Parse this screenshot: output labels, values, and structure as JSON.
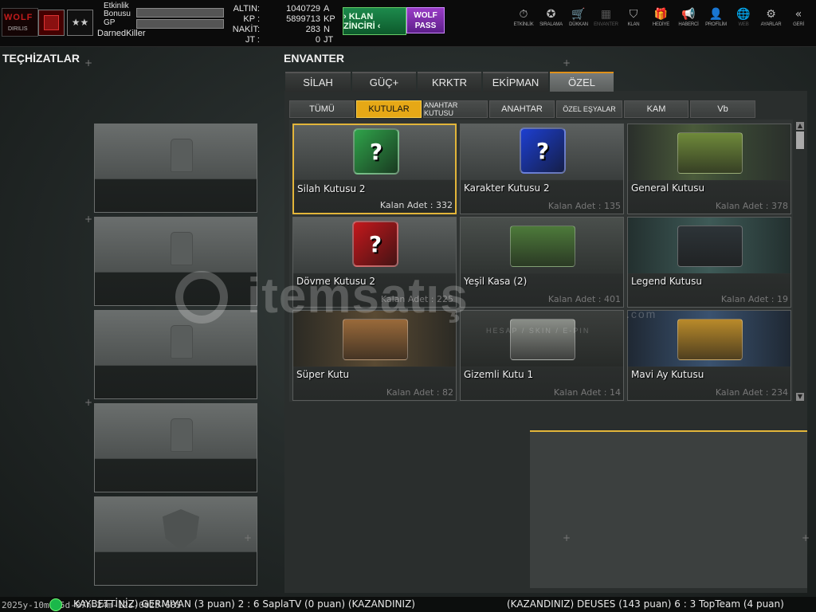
{
  "player": {
    "logo_text": "WOLF",
    "logo_sub": "DIRILIS",
    "rank_stars": "★★",
    "event_bonus_label": "Etkinlik Bonusu",
    "gp_label": "GP",
    "name": "DarnedKiller"
  },
  "currency": {
    "labels": "ALTIN:\nKP :\nNAKİT:\nJT :",
    "values": "1040729\n5899713\n283\n0",
    "units": "A\nKP\nN\nJT"
  },
  "buttons": {
    "klan": "› KLAN ZİNCİRİ ‹",
    "wolf_pass": "WOLF\nPASS"
  },
  "nav": [
    {
      "icon": "stopwatch-icon",
      "glyph": "⏱",
      "label": "ETKİNLİK"
    },
    {
      "icon": "medal-icon",
      "glyph": "✪",
      "label": "SIRALAMA"
    },
    {
      "icon": "cart-icon",
      "glyph": "🛒",
      "label": "DÜKKAN"
    },
    {
      "icon": "inventory-icon",
      "glyph": "▦",
      "label": "ENVANTER"
    },
    {
      "icon": "clan-shield-icon",
      "glyph": "⛉",
      "label": "KLAN"
    },
    {
      "icon": "gift-icon",
      "glyph": "🎁",
      "label": "HEDİYE"
    },
    {
      "icon": "megaphone-icon",
      "glyph": "📢",
      "label": "HABERCİ"
    },
    {
      "icon": "profile-icon",
      "glyph": "👤",
      "label": "PROFİLİM"
    },
    {
      "icon": "globe-icon",
      "glyph": "🌐",
      "label": "WEB"
    },
    {
      "icon": "gear-icon",
      "glyph": "⚙",
      "label": "AYARLAR"
    },
    {
      "icon": "back-arrows-icon",
      "glyph": "«",
      "label": "GERİ"
    }
  ],
  "equipment": {
    "title": "TEÇHİZATLAR"
  },
  "inventory": {
    "title": "ENVANTER",
    "main_tabs": [
      "SİLAH",
      "GÜÇ+",
      "KRKTR",
      "EKİPMAN",
      "ÖZEL"
    ],
    "active_main_tab": "ÖZEL",
    "sub_tabs": [
      "TÜMÜ",
      "KUTULAR",
      "ANAHTAR KUTUSU",
      "ANAHTAR",
      "ÖZEL EŞYALAR",
      "KAM",
      "Vb"
    ],
    "active_sub_tab": "KUTULAR",
    "items": [
      {
        "name": "Silah Kutusu 2",
        "qty": "Kalan Adet : 332",
        "icon": "green-mystery-box-icon"
      },
      {
        "name": "Karakter Kutusu 2",
        "qty": "Kalan Adet : 135",
        "icon": "blue-mystery-box-icon"
      },
      {
        "name": "General Kutusu",
        "qty": "Kalan Adet : 378",
        "icon": "general-chest-icon"
      },
      {
        "name": "Dövme Kutusu 2",
        "qty": "Kalan Adet : 225",
        "icon": "red-mystery-box-icon"
      },
      {
        "name": "Yeşil Kasa (2)",
        "qty": "Kalan Adet : 401",
        "icon": "green-crate-icon"
      },
      {
        "name": "Legend Kutusu",
        "qty": "Kalan Adet : 19",
        "icon": "legend-chest-icon"
      },
      {
        "name": "Süper Kutu",
        "qty": "Kalan Adet : 82",
        "icon": "gift-box-icon"
      },
      {
        "name": "Gizemli Kutu 1",
        "qty": "Kalan Adet : 14",
        "icon": "mystery-capsule-icon"
      },
      {
        "name": "Mavi Ay Kutusu",
        "qty": "Kalan Adet : 234",
        "icon": "blue-moon-chest-icon"
      }
    ]
  },
  "watermark": {
    "text": "itemsatış",
    "sub": "HESAP / SKIN / E-PIN",
    "domain": ".com"
  },
  "ticker": {
    "timestamp": "2025y-10m-05d-07h-24m-12s-0025-685",
    "left": "KAYBETTİNİZ) GERMIYAN (3 puan) 2 : 6 SaplaTV (0 puan) (KAZANDINIZ)",
    "right": "(KAZANDINIZ) DEUSES (143 puan) 6 : 3 TopTeam (4 puan)"
  },
  "colors": {
    "accent": "#e6a816",
    "klan_green": "#1d8a4c",
    "wolf_purple": "#9a3cc7",
    "status_green": "#1bb84a"
  }
}
